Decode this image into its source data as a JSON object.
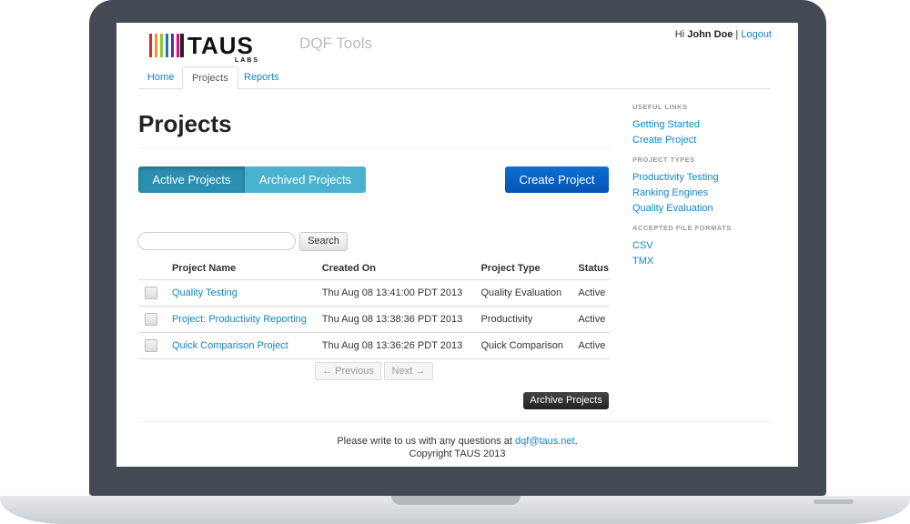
{
  "brand": {
    "logo_text": "TAUS",
    "logo_sub": "LABS",
    "app_title": "DQF Tools",
    "logo_colors": [
      "#e4262c",
      "#f7941d",
      "#8dc63f",
      "#1c75bc",
      "#662d91",
      "#ec008c"
    ]
  },
  "user": {
    "greeting": "Hi",
    "name": "John Doe",
    "separator": "|",
    "logout": "Logout"
  },
  "nav": {
    "tabs": [
      "Home",
      "Projects",
      "Reports"
    ],
    "active": "Projects"
  },
  "page": {
    "title": "Projects"
  },
  "toggle": {
    "active": "Active Projects",
    "archived": "Archived Projects"
  },
  "create_label": "Create Project",
  "search": {
    "placeholder": "",
    "button": "Search"
  },
  "table": {
    "headers": [
      "Project Name",
      "Created On",
      "Project Type",
      "Status"
    ],
    "rows": [
      [
        "Quality Testing",
        "Thu Aug 08 13:41:00 PDT 2013",
        "Quality Evaluation",
        "Active"
      ],
      [
        "Project: Productivity Reporting",
        "Thu Aug 08 13:38:36 PDT 2013",
        "Productivity",
        "Active"
      ],
      [
        "Quick Comparison Project",
        "Thu Aug 08 13:36:26 PDT 2013",
        "Quick Comparison",
        "Active"
      ]
    ]
  },
  "pagination": {
    "prev": "← Previous",
    "next": "Next →"
  },
  "archive_label": "Archive Projects",
  "sidebar": {
    "useful_links": {
      "heading": "USEFUL LINKS",
      "items": [
        "Getting Started",
        "Create Project"
      ]
    },
    "project_types": {
      "heading": "PROJECT TYPES",
      "items": [
        "Productivity Testing",
        "Ranking Engines",
        "Quality Evaluation"
      ]
    },
    "file_formats": {
      "heading": "ACCEPTED FILE FORMATS",
      "items": [
        "CSV",
        "TMX"
      ]
    }
  },
  "footer": {
    "line1_prefix": "Please write to us with any questions at ",
    "email": "dqf@taus.net",
    "line1_suffix": ".",
    "line2": "Copyright TAUS 2013"
  },
  "colors": {
    "link": "#0e86c9",
    "primary": "#0a6fd6",
    "toggle_active": "#2b8fb0",
    "toggle": "#4ab1cf",
    "bezel": "#434a53"
  }
}
